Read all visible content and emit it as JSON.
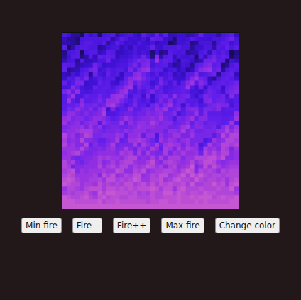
{
  "fire": {
    "level": 0.85
  },
  "buttons": [
    "Min fire",
    "Fire--",
    "Fire++",
    "Max fire",
    "Change color"
  ]
}
